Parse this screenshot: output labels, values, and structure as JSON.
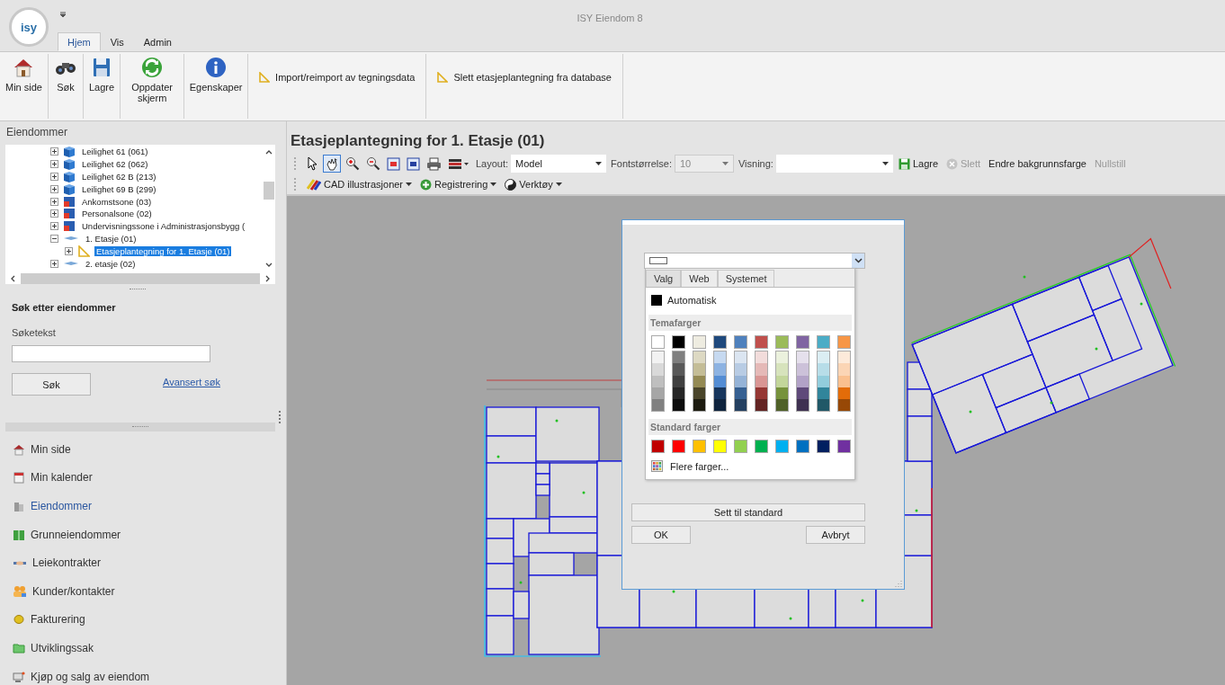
{
  "app": {
    "logo": "isy",
    "title": "ISY Eiendom 8"
  },
  "ribbon_tabs": [
    {
      "label": "Hjem",
      "selected": true
    },
    {
      "label": "Vis",
      "selected": false
    },
    {
      "label": "Admin",
      "selected": false
    }
  ],
  "ribbon_buttons": [
    {
      "label": "Min side",
      "kind": "home"
    },
    {
      "label": "Søk",
      "kind": "binoculars"
    },
    {
      "label": "Lagre",
      "kind": "save"
    },
    {
      "label": "Oppdater skjerm",
      "kind": "refresh"
    },
    {
      "label": "Egenskaper",
      "kind": "info"
    },
    {
      "label": "Import/reimport av tegningsdata",
      "kind": "ruler"
    },
    {
      "label": "Slett etasjeplantegning fra database",
      "kind": "ruler"
    }
  ],
  "properties_panel": {
    "title": "Eiendommer",
    "tree": [
      {
        "label": "Leilighet 61 (061)",
        "kind": "apartment",
        "expanded": false,
        "selected": false
      },
      {
        "label": "Leilighet 62 (062)",
        "kind": "apartment",
        "expanded": false,
        "selected": false
      },
      {
        "label": "Leilighet 62 B (213)",
        "kind": "apartment",
        "expanded": false,
        "selected": false
      },
      {
        "label": "Leilighet 69 B (299)",
        "kind": "apartment",
        "expanded": false,
        "selected": false
      },
      {
        "label": "Ankomstsone (03)",
        "kind": "zone",
        "expanded": false,
        "selected": false
      },
      {
        "label": "Personalsone (02)",
        "kind": "zone",
        "expanded": false,
        "selected": false
      },
      {
        "label": "Undervisningssone i Administrasjonsbygg (",
        "kind": "zone",
        "expanded": false,
        "selected": false
      },
      {
        "label": "1. Etasje (01)",
        "kind": "floor",
        "expanded": true,
        "selected": false,
        "children": [
          {
            "label": "Etasjeplantegning for 1. Etasje (01)",
            "kind": "drawing",
            "expanded": false,
            "selected": true
          }
        ]
      },
      {
        "label": "2. etasje (02)",
        "kind": "floor",
        "expanded": false,
        "selected": false
      }
    ]
  },
  "search": {
    "title": "Søk etter eiendommer",
    "label": "Søketekst",
    "button": "Søk",
    "link": "Avansert søk"
  },
  "nav": [
    {
      "label": "Min side",
      "kind": "home",
      "selected": false
    },
    {
      "label": "Min kalender",
      "kind": "calendar",
      "selected": false
    },
    {
      "label": "Eiendommer",
      "kind": "buildings",
      "selected": true
    },
    {
      "label": "Grunneiendommer",
      "kind": "land",
      "selected": false
    },
    {
      "label": "Leiekontrakter",
      "kind": "handshake",
      "selected": false
    },
    {
      "label": "Kunder/kontakter",
      "kind": "people",
      "selected": false
    },
    {
      "label": "Fakturering",
      "kind": "coin",
      "selected": false
    },
    {
      "label": "Utviklingssak",
      "kind": "folder",
      "selected": false
    },
    {
      "label": "Kjøp og salg av eiendom",
      "kind": "computer",
      "selected": false
    }
  ],
  "main": {
    "title": "Etasjeplantegning for 1. Etasje (01)",
    "tools": [
      {
        "kind": "pointer",
        "selected": false
      },
      {
        "kind": "hand",
        "selected": true
      },
      {
        "kind": "zoom-in",
        "selected": false
      },
      {
        "kind": "zoom-out",
        "selected": false
      },
      {
        "kind": "fit",
        "selected": false
      },
      {
        "kind": "fit-all",
        "selected": false
      },
      {
        "kind": "printer",
        "selected": false
      },
      {
        "kind": "layers",
        "selected": false
      }
    ],
    "layout": {
      "label": "Layout:",
      "value": "Model"
    },
    "font_size": {
      "label": "Fontstørrelse:",
      "value": "10",
      "disabled": true
    },
    "view": {
      "label": "Visning:"
    },
    "actions": [
      {
        "label": "Lagre",
        "kind": "save",
        "disabled": false
      },
      {
        "label": "Slett",
        "kind": "delete",
        "disabled": true
      },
      {
        "label": "Endre bakgrunnsfarge",
        "kind": "text",
        "disabled": false
      },
      {
        "label": "Nullstill",
        "kind": "text",
        "disabled": true
      }
    ],
    "menus": [
      {
        "label": "CAD illustrasjoner",
        "kind": "pencils"
      },
      {
        "label": "Registrering",
        "kind": "plus"
      },
      {
        "label": "Verktøy",
        "kind": "yinyang"
      }
    ]
  },
  "color_dialog": {
    "value": {
      "color": "#ffffff"
    },
    "tabs": [
      {
        "label": "Valg",
        "selected": true
      },
      {
        "label": "Web",
        "selected": false
      },
      {
        "label": "Systemet",
        "selected": false
      }
    ],
    "automatic": {
      "label": "Automatisk",
      "color": "#000000"
    },
    "theme_title": "Temafarger",
    "theme_colors": [
      {
        "color": "#ffffff",
        "shades": [
          {
            "color": "#f2f2f2"
          },
          {
            "color": "#d9d9d9"
          },
          {
            "color": "#bfbfbf"
          },
          {
            "color": "#a6a6a6"
          },
          {
            "color": "#808080"
          }
        ]
      },
      {
        "color": "#000000",
        "shades": [
          {
            "color": "#7f7f7f"
          },
          {
            "color": "#595959"
          },
          {
            "color": "#404040"
          },
          {
            "color": "#262626"
          },
          {
            "color": "#0d0d0d"
          }
        ]
      },
      {
        "color": "#eeece1",
        "shades": [
          {
            "color": "#ddd9c3"
          },
          {
            "color": "#c4bd97"
          },
          {
            "color": "#948a54"
          },
          {
            "color": "#4a452a"
          },
          {
            "color": "#1d1b10"
          }
        ]
      },
      {
        "color": "#1f497d",
        "shades": [
          {
            "color": "#c6d9f0"
          },
          {
            "color": "#8db3e2"
          },
          {
            "color": "#548dd4"
          },
          {
            "color": "#17365d"
          },
          {
            "color": "#0f243e"
          }
        ]
      },
      {
        "color": "#4f81bd",
        "shades": [
          {
            "color": "#dbe5f1"
          },
          {
            "color": "#b8cce4"
          },
          {
            "color": "#95b3d7"
          },
          {
            "color": "#366092"
          },
          {
            "color": "#244061"
          }
        ]
      },
      {
        "color": "#c0504d",
        "shades": [
          {
            "color": "#f2dcdb"
          },
          {
            "color": "#e5b9b7"
          },
          {
            "color": "#d99694"
          },
          {
            "color": "#953734"
          },
          {
            "color": "#632423"
          }
        ]
      },
      {
        "color": "#9bbb59",
        "shades": [
          {
            "color": "#ebf1dd"
          },
          {
            "color": "#d7e3bc"
          },
          {
            "color": "#c3d69b"
          },
          {
            "color": "#76923c"
          },
          {
            "color": "#4f6128"
          }
        ]
      },
      {
        "color": "#8064a2",
        "shades": [
          {
            "color": "#e5e0ec"
          },
          {
            "color": "#ccc1d9"
          },
          {
            "color": "#b2a2c7"
          },
          {
            "color": "#5f497a"
          },
          {
            "color": "#3f3151"
          }
        ]
      },
      {
        "color": "#4bacc6",
        "shades": [
          {
            "color": "#dbeef3"
          },
          {
            "color": "#b7dde8"
          },
          {
            "color": "#92cddc"
          },
          {
            "color": "#31859b"
          },
          {
            "color": "#205867"
          }
        ]
      },
      {
        "color": "#f79646",
        "shades": [
          {
            "color": "#fdeada"
          },
          {
            "color": "#fbd5b5"
          },
          {
            "color": "#fac08f"
          },
          {
            "color": "#e36c09"
          },
          {
            "color": "#974806"
          }
        ]
      }
    ],
    "standard_title": "Standard farger",
    "standard_colors": [
      {
        "color": "#c00000"
      },
      {
        "color": "#ff0000"
      },
      {
        "color": "#ffc000"
      },
      {
        "color": "#ffff00"
      },
      {
        "color": "#92d050"
      },
      {
        "color": "#00b050"
      },
      {
        "color": "#00b0f0"
      },
      {
        "color": "#0070c0"
      },
      {
        "color": "#002060"
      },
      {
        "color": "#7030a0"
      }
    ],
    "more": "Flere farger...",
    "reset_button": "Sett til standard",
    "ok_button": "OK",
    "cancel_button": "Avbryt"
  }
}
